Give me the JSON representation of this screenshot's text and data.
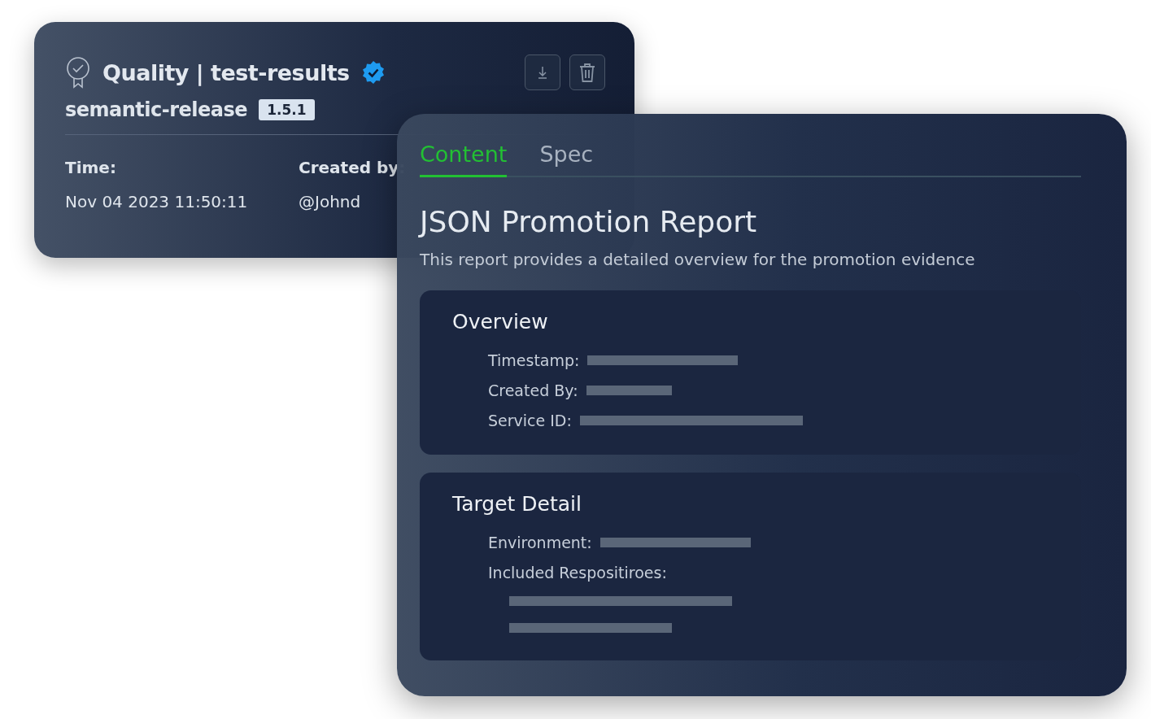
{
  "release_card": {
    "title": "Quality | test-results",
    "verified": true,
    "package": "semantic-release",
    "version": "1.5.1",
    "fields": [
      {
        "label": "Time:",
        "value": "Nov 04 2023  11:50:11"
      },
      {
        "label": "Created by:",
        "value": "@Johnd"
      }
    ]
  },
  "report_panel": {
    "tabs": [
      {
        "label": "Content",
        "selected": true
      },
      {
        "label": "Spec",
        "selected": false
      }
    ],
    "title": "JSON Promotion Report",
    "description": "This report provides a detailed overview for the promotion evidence",
    "sections": [
      {
        "title": "Overview",
        "rows": [
          {
            "label": "Timestamp:",
            "redacted": true,
            "kind": "inline"
          },
          {
            "label": "Created By:",
            "redacted": true,
            "kind": "inline"
          },
          {
            "label": "Service ID:",
            "redacted": true,
            "kind": "inline"
          }
        ]
      },
      {
        "title": "Target Detail",
        "rows": [
          {
            "label": "Environment:",
            "redacted": true,
            "kind": "inline"
          },
          {
            "label": "Included Respositiroes:",
            "kind": "list",
            "items": [
              {
                "redacted": true
              },
              {
                "redacted": true
              }
            ]
          }
        ]
      }
    ]
  }
}
